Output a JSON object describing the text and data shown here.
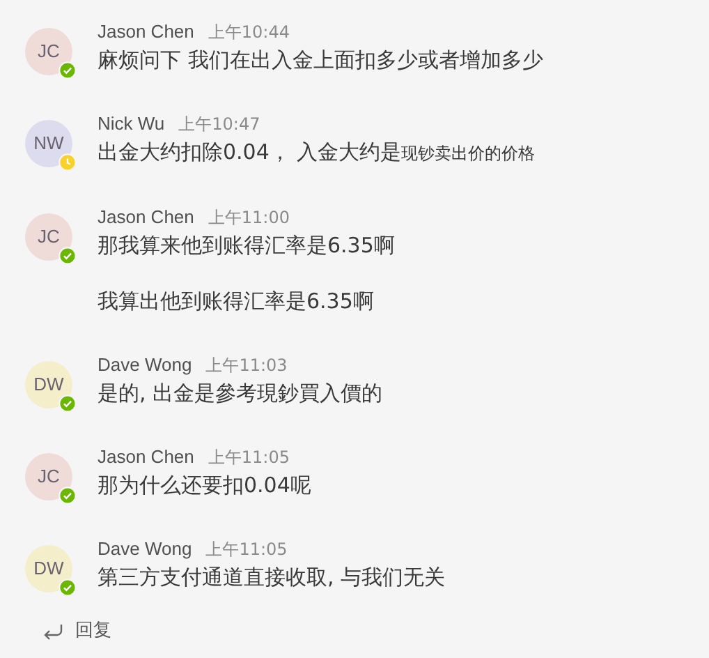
{
  "messages": [
    {
      "initials": "JC",
      "color": "#efdcd9",
      "away": false,
      "author": "Jason Chen",
      "time": "上午10:44",
      "lines": [
        [
          {
            "kind": "normal",
            "text": "麻烦问下 我们在出入金上面扣多少或者增加多少"
          }
        ]
      ]
    },
    {
      "initials": "NW",
      "color": "#dddcee",
      "away": true,
      "author": "Nick Wu",
      "time": "上午10:47",
      "lines": [
        [
          {
            "kind": "normal",
            "text": "出金大约扣除0.04， 入金大约是"
          },
          {
            "kind": "small",
            "text": "现钞卖出价的价格"
          }
        ]
      ]
    },
    {
      "initials": "JC",
      "color": "#efdcd9",
      "away": false,
      "author": "Jason Chen",
      "time": "上午11:00",
      "lines": [
        [
          {
            "kind": "normal",
            "text": "那我算来他到账得汇率是6.35啊"
          }
        ],
        [
          {
            "kind": "normal",
            "text": "我算出他到账得汇率是6.35啊"
          }
        ]
      ]
    },
    {
      "initials": "DW",
      "color": "#f4eecb",
      "away": false,
      "author": "Dave Wong",
      "time": "上午11:03",
      "lines": [
        [
          {
            "kind": "normal",
            "text": "是的, 出金是參考現鈔買入價的"
          }
        ]
      ]
    },
    {
      "initials": "JC",
      "color": "#efdcd9",
      "away": false,
      "author": "Jason Chen",
      "time": "上午11:05",
      "lines": [
        [
          {
            "kind": "normal",
            "text": "那为什么还要扣0.04呢"
          }
        ]
      ]
    },
    {
      "initials": "DW",
      "color": "#f4eecb",
      "away": false,
      "author": "Dave Wong",
      "time": "上午11:05",
      "lines": [
        [
          {
            "kind": "normal",
            "text": "第三方支付通道直接收取, 与我们无关"
          }
        ]
      ]
    }
  ],
  "reply": {
    "label": "回复"
  }
}
